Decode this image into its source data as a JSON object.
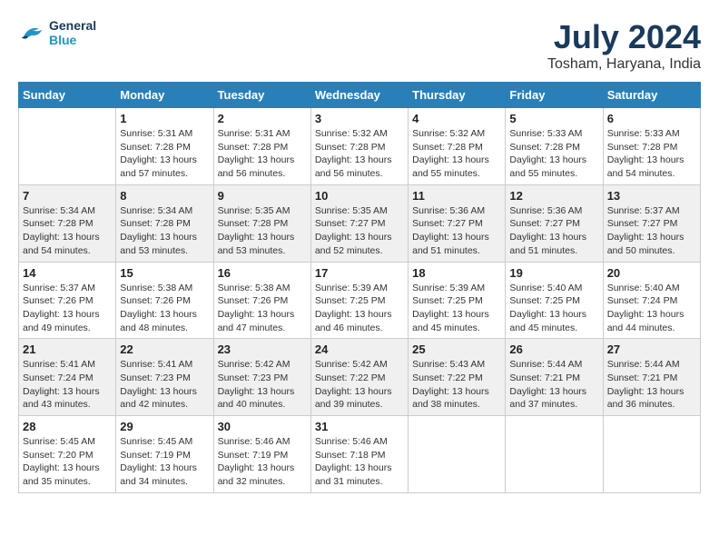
{
  "header": {
    "logo_line1": "General",
    "logo_line2": "Blue",
    "month_year": "July 2024",
    "location": "Tosham, Haryana, India"
  },
  "days_of_week": [
    "Sunday",
    "Monday",
    "Tuesday",
    "Wednesday",
    "Thursday",
    "Friday",
    "Saturday"
  ],
  "weeks": [
    [
      {
        "day": "",
        "sunrise": "",
        "sunset": "",
        "daylight": ""
      },
      {
        "day": "1",
        "sunrise": "5:31 AM",
        "sunset": "7:28 PM",
        "daylight": "13 hours and 57 minutes."
      },
      {
        "day": "2",
        "sunrise": "5:31 AM",
        "sunset": "7:28 PM",
        "daylight": "13 hours and 56 minutes."
      },
      {
        "day": "3",
        "sunrise": "5:32 AM",
        "sunset": "7:28 PM",
        "daylight": "13 hours and 56 minutes."
      },
      {
        "day": "4",
        "sunrise": "5:32 AM",
        "sunset": "7:28 PM",
        "daylight": "13 hours and 55 minutes."
      },
      {
        "day": "5",
        "sunrise": "5:33 AM",
        "sunset": "7:28 PM",
        "daylight": "13 hours and 55 minutes."
      },
      {
        "day": "6",
        "sunrise": "5:33 AM",
        "sunset": "7:28 PM",
        "daylight": "13 hours and 54 minutes."
      }
    ],
    [
      {
        "day": "7",
        "sunrise": "5:34 AM",
        "sunset": "7:28 PM",
        "daylight": "13 hours and 54 minutes."
      },
      {
        "day": "8",
        "sunrise": "5:34 AM",
        "sunset": "7:28 PM",
        "daylight": "13 hours and 53 minutes."
      },
      {
        "day": "9",
        "sunrise": "5:35 AM",
        "sunset": "7:28 PM",
        "daylight": "13 hours and 53 minutes."
      },
      {
        "day": "10",
        "sunrise": "5:35 AM",
        "sunset": "7:27 PM",
        "daylight": "13 hours and 52 minutes."
      },
      {
        "day": "11",
        "sunrise": "5:36 AM",
        "sunset": "7:27 PM",
        "daylight": "13 hours and 51 minutes."
      },
      {
        "day": "12",
        "sunrise": "5:36 AM",
        "sunset": "7:27 PM",
        "daylight": "13 hours and 51 minutes."
      },
      {
        "day": "13",
        "sunrise": "5:37 AM",
        "sunset": "7:27 PM",
        "daylight": "13 hours and 50 minutes."
      }
    ],
    [
      {
        "day": "14",
        "sunrise": "5:37 AM",
        "sunset": "7:26 PM",
        "daylight": "13 hours and 49 minutes."
      },
      {
        "day": "15",
        "sunrise": "5:38 AM",
        "sunset": "7:26 PM",
        "daylight": "13 hours and 48 minutes."
      },
      {
        "day": "16",
        "sunrise": "5:38 AM",
        "sunset": "7:26 PM",
        "daylight": "13 hours and 47 minutes."
      },
      {
        "day": "17",
        "sunrise": "5:39 AM",
        "sunset": "7:25 PM",
        "daylight": "13 hours and 46 minutes."
      },
      {
        "day": "18",
        "sunrise": "5:39 AM",
        "sunset": "7:25 PM",
        "daylight": "13 hours and 45 minutes."
      },
      {
        "day": "19",
        "sunrise": "5:40 AM",
        "sunset": "7:25 PM",
        "daylight": "13 hours and 45 minutes."
      },
      {
        "day": "20",
        "sunrise": "5:40 AM",
        "sunset": "7:24 PM",
        "daylight": "13 hours and 44 minutes."
      }
    ],
    [
      {
        "day": "21",
        "sunrise": "5:41 AM",
        "sunset": "7:24 PM",
        "daylight": "13 hours and 43 minutes."
      },
      {
        "day": "22",
        "sunrise": "5:41 AM",
        "sunset": "7:23 PM",
        "daylight": "13 hours and 42 minutes."
      },
      {
        "day": "23",
        "sunrise": "5:42 AM",
        "sunset": "7:23 PM",
        "daylight": "13 hours and 40 minutes."
      },
      {
        "day": "24",
        "sunrise": "5:42 AM",
        "sunset": "7:22 PM",
        "daylight": "13 hours and 39 minutes."
      },
      {
        "day": "25",
        "sunrise": "5:43 AM",
        "sunset": "7:22 PM",
        "daylight": "13 hours and 38 minutes."
      },
      {
        "day": "26",
        "sunrise": "5:44 AM",
        "sunset": "7:21 PM",
        "daylight": "13 hours and 37 minutes."
      },
      {
        "day": "27",
        "sunrise": "5:44 AM",
        "sunset": "7:21 PM",
        "daylight": "13 hours and 36 minutes."
      }
    ],
    [
      {
        "day": "28",
        "sunrise": "5:45 AM",
        "sunset": "7:20 PM",
        "daylight": "13 hours and 35 minutes."
      },
      {
        "day": "29",
        "sunrise": "5:45 AM",
        "sunset": "7:19 PM",
        "daylight": "13 hours and 34 minutes."
      },
      {
        "day": "30",
        "sunrise": "5:46 AM",
        "sunset": "7:19 PM",
        "daylight": "13 hours and 32 minutes."
      },
      {
        "day": "31",
        "sunrise": "5:46 AM",
        "sunset": "7:18 PM",
        "daylight": "13 hours and 31 minutes."
      },
      {
        "day": "",
        "sunrise": "",
        "sunset": "",
        "daylight": ""
      },
      {
        "day": "",
        "sunrise": "",
        "sunset": "",
        "daylight": ""
      },
      {
        "day": "",
        "sunrise": "",
        "sunset": "",
        "daylight": ""
      }
    ]
  ],
  "labels": {
    "sunrise": "Sunrise:",
    "sunset": "Sunset:",
    "daylight": "Daylight:"
  }
}
